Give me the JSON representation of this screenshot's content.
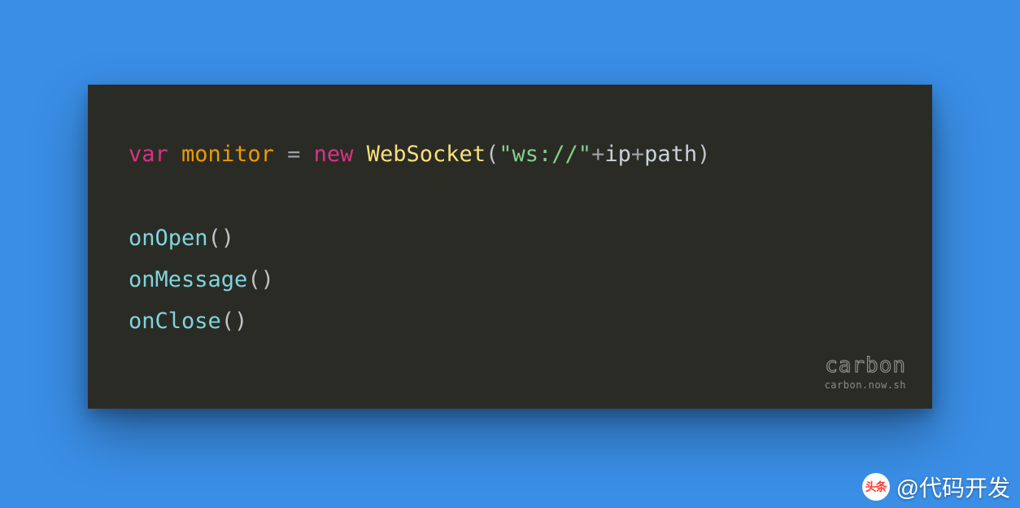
{
  "code": {
    "line1": {
      "kw": "var",
      "varname": "monitor",
      "eq": "=",
      "newkw": "new",
      "cls": "WebSocket",
      "lp": "(",
      "str": "\"ws://\"",
      "plus1": "+",
      "id1": "ip",
      "plus2": "+",
      "id2": "path",
      "rp": ")"
    },
    "line3": {
      "fn": "onOpen",
      "args": "()"
    },
    "line4": {
      "fn": "onMessage",
      "args": "()"
    },
    "line5": {
      "fn": "onClose",
      "args": "()"
    }
  },
  "watermark": {
    "brand": "carbon",
    "url": "carbon.now.sh"
  },
  "attribution": {
    "logo": "头条",
    "handle": "@代码开发"
  }
}
